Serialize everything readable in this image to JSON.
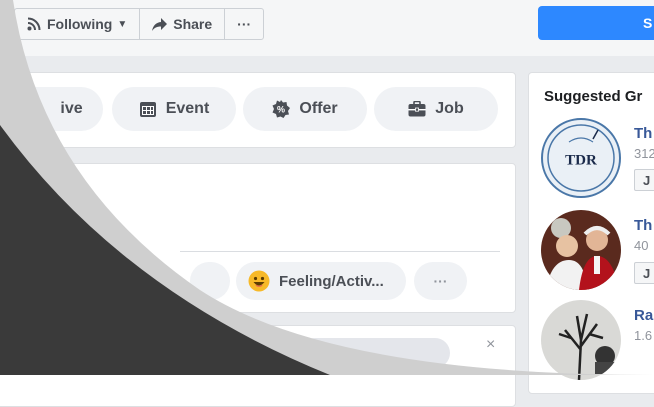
{
  "toolbar": {
    "following_label": "Following",
    "share_label": "Share",
    "more_label": "···"
  },
  "header_button_label": "S",
  "composer": {
    "actions": [
      {
        "label": "ive",
        "icon": "live-video-icon"
      },
      {
        "label": "Event",
        "icon": "calendar-icon"
      },
      {
        "label": "Offer",
        "icon": "offer-tag-icon"
      },
      {
        "label": "Job",
        "icon": "briefcase-icon"
      }
    ],
    "feeling_label": "Feeling/Activ...",
    "more_label": "···"
  },
  "sidebar": {
    "title": "Suggested Gr",
    "groups": [
      {
        "name": "Th",
        "meta": "312",
        "join_label": "J",
        "avatar_text": "TDR"
      },
      {
        "name": "Th",
        "meta": "40",
        "join_label": "J"
      },
      {
        "name": "Ra",
        "meta": "1.6"
      }
    ]
  },
  "dismiss_label": "×",
  "colors": {
    "primary": "#2d88ff",
    "link": "#385898",
    "overlay_dark": "#3a3a3a",
    "overlay_light": "#cfcfcf"
  }
}
